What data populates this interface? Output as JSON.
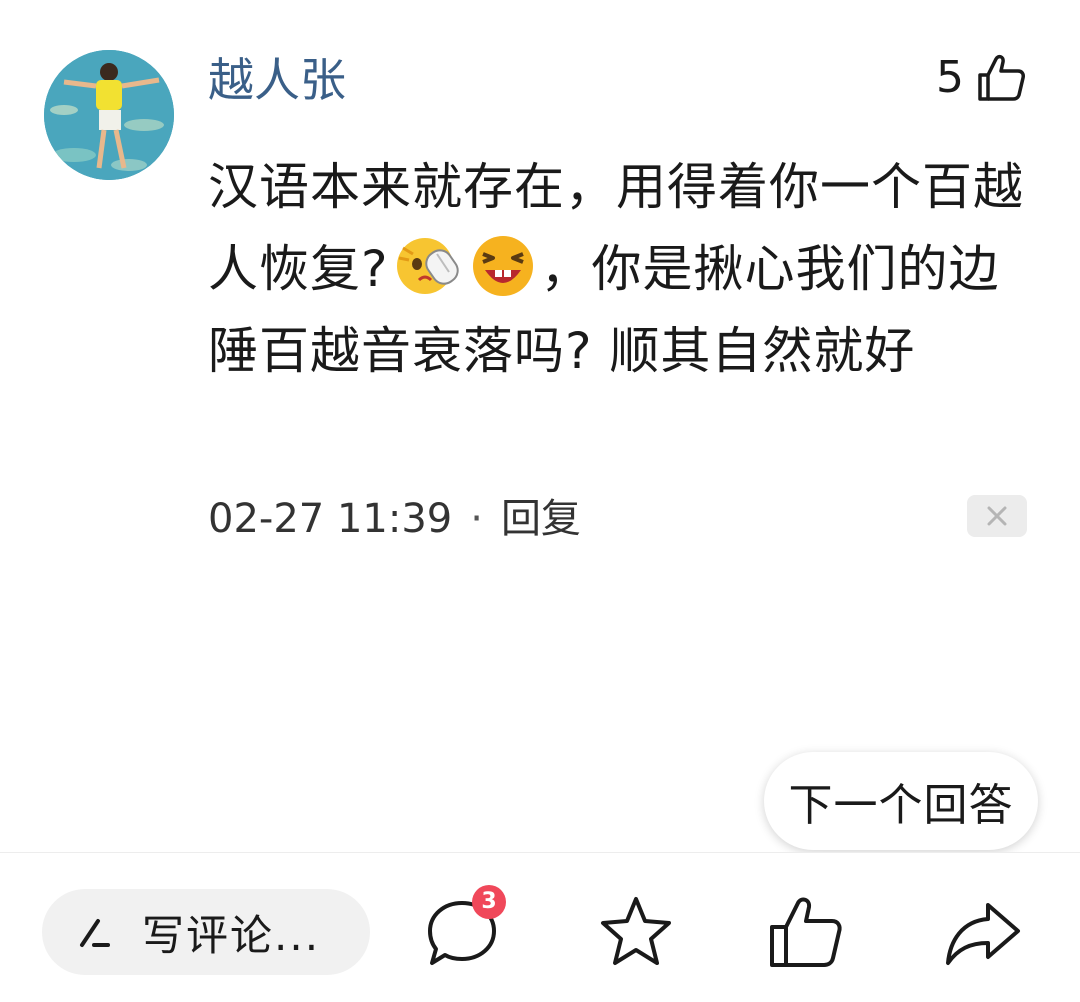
{
  "comment": {
    "author": "越人张",
    "like_count": "5",
    "text_part1": "汉语本来就存在，用得着你一个百越人恢复?",
    "text_part2": "，你是揪心我们的边陲百越音衰落吗? 顺其自然就好",
    "timestamp": "02-27 11:39",
    "separator": "·",
    "reply_label": "回复",
    "icons": {
      "like": "thumbs-up-icon",
      "close": "close-icon",
      "emoji1": "slap-face-emoji",
      "emoji2": "laughing-face-emoji"
    }
  },
  "floating": {
    "next_answer_label": "下一个回答"
  },
  "bottom_bar": {
    "write_comment_label": "写评论...",
    "comment_badge": "3",
    "icons": [
      "pen-icon",
      "comment-bubble-icon",
      "star-icon",
      "thumbs-up-icon",
      "share-icon"
    ],
    "colors": {
      "badge": "#f0485a",
      "author": "#3a5f88"
    }
  }
}
